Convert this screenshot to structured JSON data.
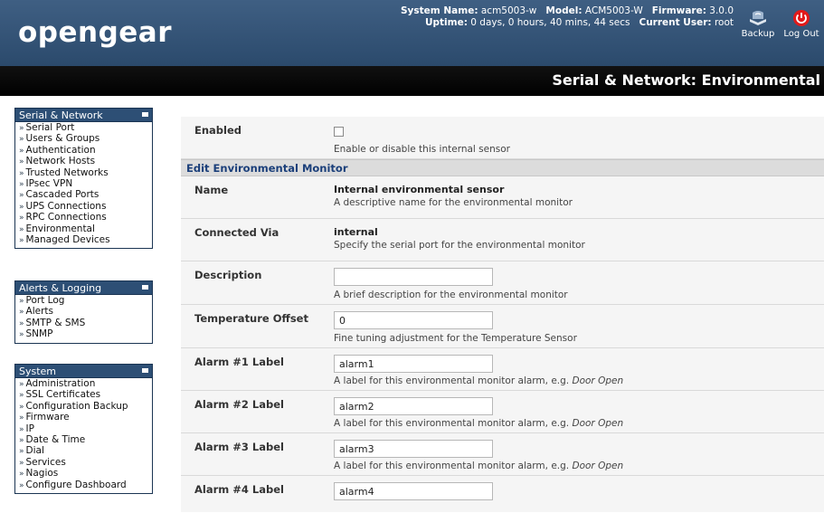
{
  "header": {
    "logo": "opengear",
    "system_name_label": "System Name:",
    "system_name": "acm5003-w",
    "model_label": "Model:",
    "model": "ACM5003-W",
    "firmware_label": "Firmware:",
    "firmware": "3.0.0",
    "uptime_label": "Uptime:",
    "uptime": "0 days, 0 hours, 40 mins, 44 secs",
    "current_user_label": "Current User:",
    "current_user": "root",
    "backup_label": "Backup",
    "logout_label": "Log Out"
  },
  "title": "Serial & Network: Environmental",
  "sidebar": {
    "serial_network": {
      "title": "Serial & Network",
      "items": [
        "Serial Port",
        "Users & Groups",
        "Authentication",
        "Network Hosts",
        "Trusted Networks",
        "IPsec VPN",
        "Cascaded Ports",
        "UPS Connections",
        "RPC Connections",
        "Environmental",
        "Managed Devices"
      ]
    },
    "alerts_logging": {
      "title": "Alerts & Logging",
      "items": [
        "Port Log",
        "Alerts",
        "SMTP & SMS",
        "SNMP"
      ]
    },
    "system": {
      "title": "System",
      "items": [
        "Administration",
        "SSL Certificates",
        "Configuration Backup",
        "Firmware",
        "IP",
        "Date & Time",
        "Dial",
        "Services",
        "Nagios",
        "Configure Dashboard"
      ]
    }
  },
  "form": {
    "enabled": {
      "label": "Enabled",
      "hint": "Enable or disable this internal sensor"
    },
    "section_title": "Edit Environmental Monitor",
    "name": {
      "label": "Name",
      "value": "Internal environmental sensor",
      "hint": "A descriptive name for the environmental monitor"
    },
    "connected_via": {
      "label": "Connected Via",
      "value": "internal",
      "hint": "Specify the serial port for the environmental monitor"
    },
    "description": {
      "label": "Description",
      "value": "",
      "hint": "A brief description for the environmental monitor"
    },
    "temperature_offset": {
      "label": "Temperature Offset",
      "value": "0",
      "hint": "Fine tuning adjustment for the Temperature Sensor"
    },
    "alarm_hint_prefix": "A label for this environmental monitor alarm, e.g.",
    "alarm_hint_example": "Door Open",
    "alarm1": {
      "label": "Alarm #1 Label",
      "value": "alarm1"
    },
    "alarm2": {
      "label": "Alarm #2 Label",
      "value": "alarm2"
    },
    "alarm3": {
      "label": "Alarm #3 Label",
      "value": "alarm3"
    },
    "alarm4": {
      "label": "Alarm #4 Label",
      "value": "alarm4"
    }
  },
  "colors": {
    "header_bg": "#2b4a6c",
    "section_text": "#1b3f7a",
    "logout_red": "#e21a1a"
  }
}
